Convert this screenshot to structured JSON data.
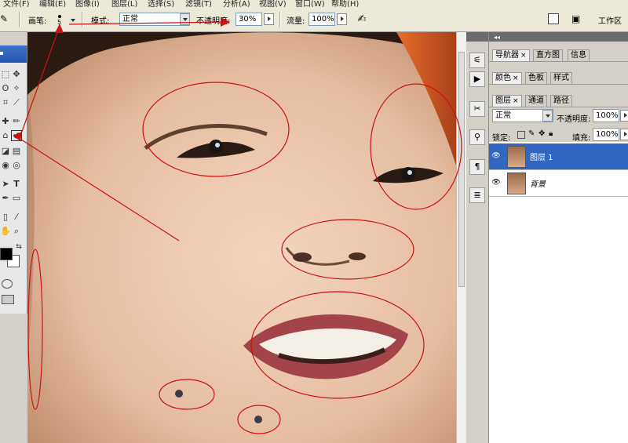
{
  "menu": [
    "文件(F)",
    "编辑(E)",
    "图像(I)",
    "图层(L)",
    "选择(S)",
    "滤镜(T)",
    "分析(A)",
    "视图(V)",
    "窗口(W)",
    "帮助(H)"
  ],
  "options": {
    "brush_label": "画笔:",
    "brush_size": "5",
    "mode_label": "模式:",
    "mode_value": "正常",
    "opacity_label": "不透明度:",
    "opacity_value": "30%",
    "flow_label": "流量:",
    "flow_value": "100%",
    "workspace_label": "工作区"
  },
  "toolbox": {
    "tools": [
      "move",
      "lasso",
      "magic-wand",
      "crop",
      "slice",
      "healing-brush",
      "brush",
      "clone-stamp",
      "history-brush",
      "eraser",
      "gradient",
      "blur",
      "dodge",
      "path-selection",
      "type",
      "pen",
      "shape",
      "notes",
      "eyedropper",
      "hand",
      "zoom"
    ],
    "foreground_color": "#000000",
    "background_color": "#ffffff"
  },
  "panels": {
    "group1_tabs": [
      "导航器",
      "直方图",
      "信息"
    ],
    "group2_tabs": [
      "颜色",
      "色板",
      "样式"
    ],
    "group3_tabs": [
      "图层",
      "通道",
      "路径"
    ],
    "blend_mode": "正常",
    "opacity_label": "不透明度:",
    "opacity_value": "100%",
    "lock_label": "锁定:",
    "fill_label": "填充:",
    "fill_value": "100%",
    "layers": [
      {
        "name": "图层 1",
        "selected": true
      },
      {
        "name": "背景",
        "selected": false
      }
    ]
  },
  "annotation_color": "#cc1111"
}
